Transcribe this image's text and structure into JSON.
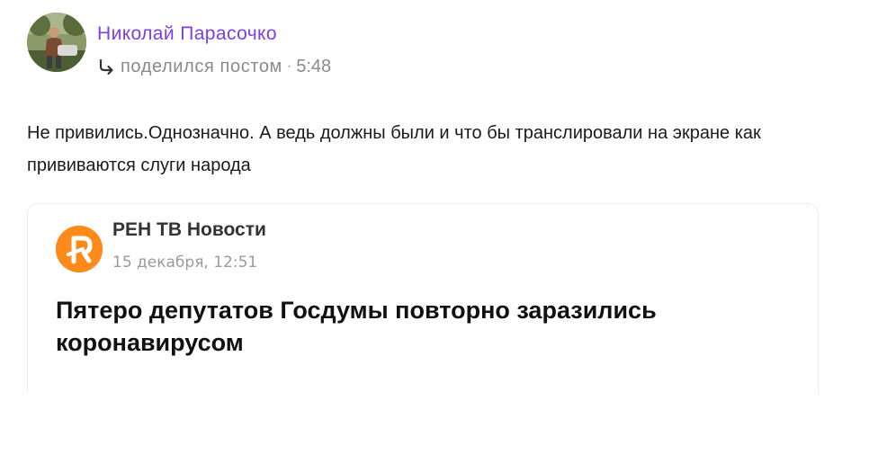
{
  "author": {
    "name": "Николай Парасочко",
    "avatar_icon": "user-avatar-photo"
  },
  "meta": {
    "share_icon": "share-arrow-icon",
    "action": "поделился постом",
    "separator": "·",
    "time": "5:48"
  },
  "post": {
    "text": "Не привились.Однозначно. А ведь должны были и что бы транслировали на экране как прививаются слуги народа"
  },
  "shared_card": {
    "source_logo_icon": "ren-tv-logo-icon",
    "source_name": "РЕН ТВ Новости",
    "date": "15 декабря, 12:51",
    "headline": "Пятеро депутатов Госдумы повторно заразились коронавирусом"
  },
  "colors": {
    "author_name": "#7b3fe4",
    "meta_text": "#8a8a8a",
    "logo_orange": "#ff8a1c",
    "card_border": "#ececec"
  }
}
